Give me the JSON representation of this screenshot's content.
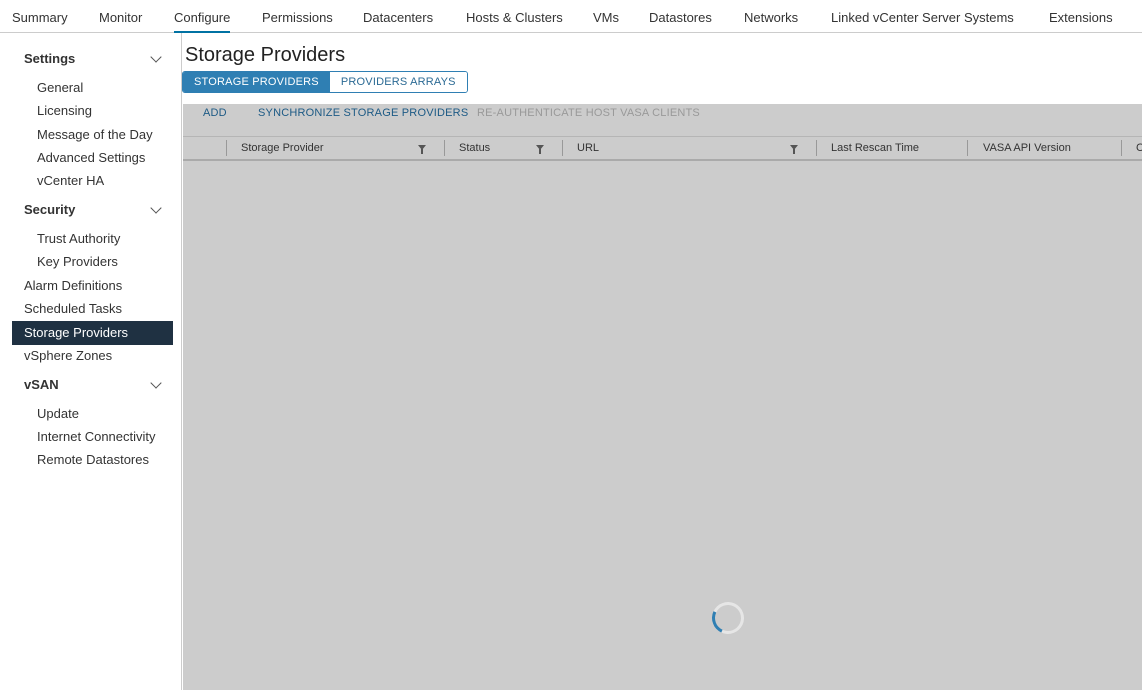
{
  "topnav": [
    "Summary",
    "Monitor",
    "Configure",
    "Permissions",
    "Datacenters",
    "Hosts & Clusters",
    "VMs",
    "Datastores",
    "Networks",
    "Linked vCenter Server Systems",
    "Extensions"
  ],
  "sidebar": {
    "settings": "Settings",
    "general": "General",
    "licensing": "Licensing",
    "motd": "Message of the Day",
    "advanced": "Advanced Settings",
    "vcha": "vCenter HA",
    "security": "Security",
    "trust": "Trust Authority",
    "keyprov": "Key Providers",
    "alarm": "Alarm Definitions",
    "sched": "Scheduled Tasks",
    "storage": "Storage Providers",
    "zones": "vSphere Zones",
    "vsan": "vSAN",
    "update": "Update",
    "internet": "Internet Connectivity",
    "remote": "Remote Datastores"
  },
  "page": {
    "title": "Storage Providers",
    "tab_active": "STORAGE PROVIDERS",
    "tab_other": "PROVIDERS ARRAYS"
  },
  "toolbar": {
    "add": "ADD",
    "sync": "SYNCHRONIZE STORAGE PROVIDERS",
    "reauth": "RE-AUTHENTICATE HOST VASA CLIENTS"
  },
  "columns": [
    "Storage Provider",
    "Status",
    "URL",
    "Last Rescan Time",
    "VASA API Version",
    "C"
  ]
}
